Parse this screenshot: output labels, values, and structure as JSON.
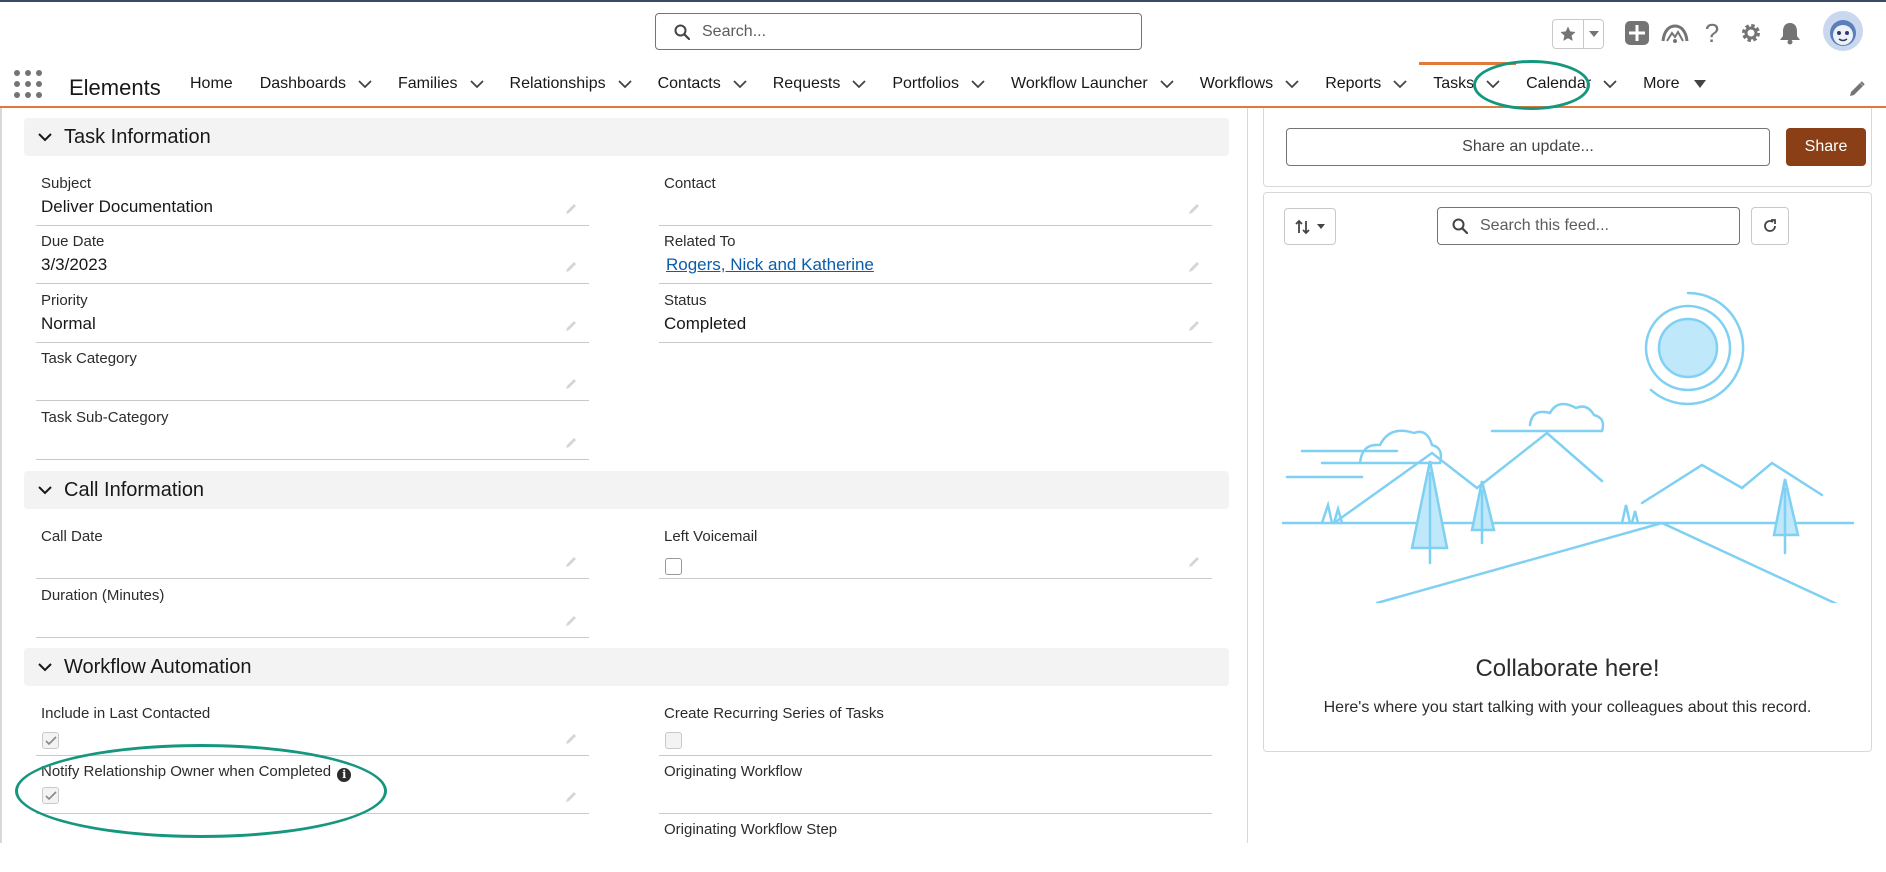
{
  "search": {
    "placeholder": "Search..."
  },
  "app": {
    "name": "Elements"
  },
  "nav": {
    "items": [
      {
        "label": "Home",
        "dropdown": false
      },
      {
        "label": "Dashboards",
        "dropdown": true
      },
      {
        "label": "Families",
        "dropdown": true
      },
      {
        "label": "Relationships",
        "dropdown": true
      },
      {
        "label": "Contacts",
        "dropdown": true
      },
      {
        "label": "Requests",
        "dropdown": true
      },
      {
        "label": "Portfolios",
        "dropdown": true
      },
      {
        "label": "Workflow Launcher",
        "dropdown": true
      },
      {
        "label": "Workflows",
        "dropdown": true
      },
      {
        "label": "Reports",
        "dropdown": true
      },
      {
        "label": "Tasks",
        "dropdown": true,
        "active": true
      },
      {
        "label": "Calendar",
        "dropdown": true
      }
    ],
    "more_label": "More"
  },
  "sections": {
    "task": {
      "title": "Task Information",
      "subject": {
        "label": "Subject",
        "value": "Deliver Documentation"
      },
      "contact": {
        "label": "Contact",
        "value": ""
      },
      "due_date": {
        "label": "Due Date",
        "value": "3/3/2023"
      },
      "related_to": {
        "label": "Related To",
        "value": "Rogers, Nick and Katherine"
      },
      "priority": {
        "label": "Priority",
        "value": "Normal"
      },
      "status": {
        "label": "Status",
        "value": "Completed"
      },
      "task_category": {
        "label": "Task Category",
        "value": ""
      },
      "task_sub_category": {
        "label": "Task Sub-Category",
        "value": ""
      }
    },
    "call": {
      "title": "Call Information",
      "call_date": {
        "label": "Call Date",
        "value": ""
      },
      "left_voicemail": {
        "label": "Left Voicemail",
        "checked": false
      },
      "duration": {
        "label": "Duration (Minutes)",
        "value": ""
      }
    },
    "workflow": {
      "title": "Workflow Automation",
      "include_last_contacted": {
        "label": "Include in Last Contacted",
        "checked": true
      },
      "create_recurring": {
        "label": "Create Recurring Series of Tasks",
        "checked": false
      },
      "notify_owner": {
        "label": "Notify Relationship Owner when Completed",
        "checked": true
      },
      "originating_workflow": {
        "label": "Originating Workflow",
        "value": ""
      },
      "originating_workflow_step": {
        "label": "Originating Workflow Step",
        "value": ""
      }
    }
  },
  "feed": {
    "share_placeholder": "Share an update...",
    "share_button": "Share",
    "search_placeholder": "Search this feed...",
    "empty_title": "Collaborate here!",
    "empty_subtitle": "Here's where you start talking with your colleagues about this record."
  },
  "colors": {
    "accent": "#e07a3a",
    "annotation": "#15977f",
    "share_button": "#8a3f17",
    "link": "#0b5cab",
    "illustration": "#7fd0f2"
  }
}
